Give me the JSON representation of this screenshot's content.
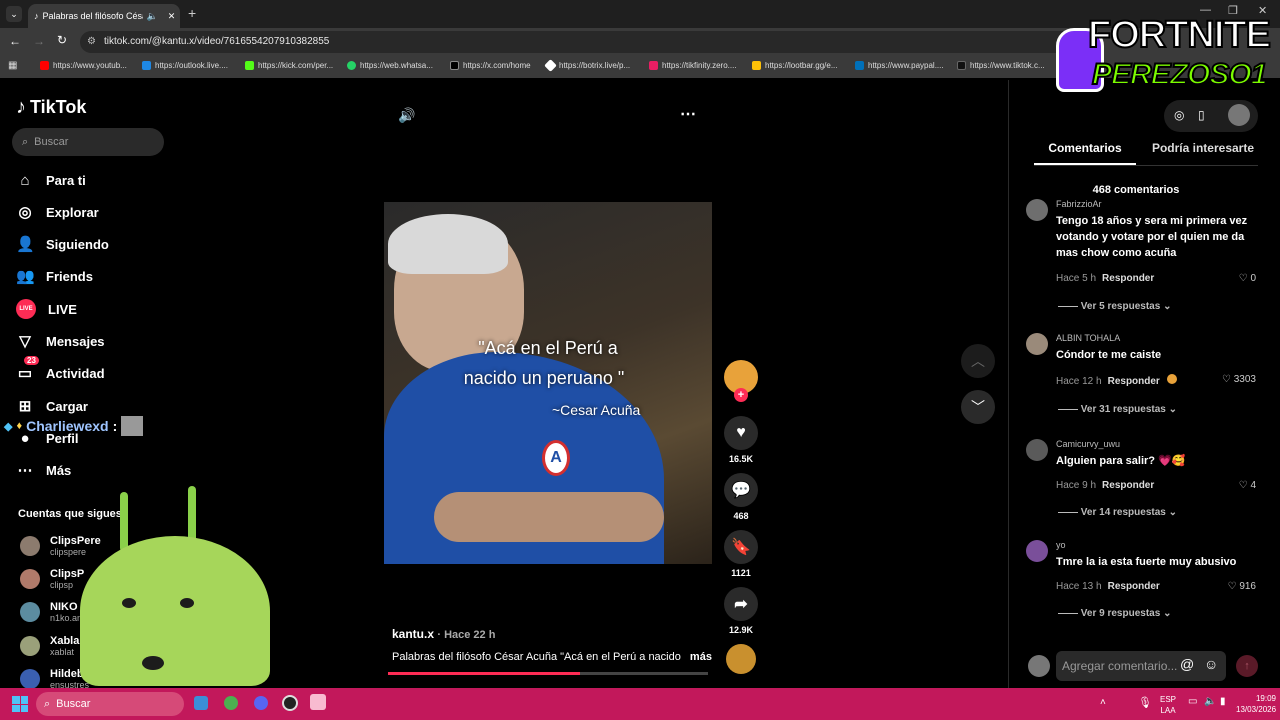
{
  "browser": {
    "tab_title": "Palabras del filósofo César A...",
    "url": "tiktok.com/@kantu.x/video/7616554207910382855",
    "bookmarks": [
      "https://www.youtub...",
      "https://outlook.live....",
      "https://kick.com/per...",
      "https://web.whatsa...",
      "https://x.com/home",
      "https://botrix.live/p...",
      "https://tikfinity.zero....",
      "https://lootbar.gg/e...",
      "https://www.paypal....",
      "https://www.tiktok.c..."
    ]
  },
  "overlay": {
    "logo_top": "FORTNITE",
    "logo_bottom": "PEREZOSO1",
    "chat_user": "Charliewexd",
    "chat_sep": ":"
  },
  "sidebar": {
    "brand": "TikTok",
    "search_placeholder": "Buscar",
    "items": [
      {
        "label": "Para ti",
        "icon": "home-icon"
      },
      {
        "label": "Explorar",
        "icon": "compass-icon"
      },
      {
        "label": "Siguiendo",
        "icon": "following-icon"
      },
      {
        "label": "Friends",
        "icon": "friends-icon"
      },
      {
        "label": "LIVE",
        "icon": "live-icon"
      },
      {
        "label": "Mensajes",
        "icon": "send-icon"
      },
      {
        "label": "Actividad",
        "icon": "activity-icon"
      },
      {
        "label": "Cargar",
        "icon": "upload-icon"
      },
      {
        "label": "Perfil",
        "icon": "profile-icon"
      },
      {
        "label": "Más",
        "icon": "more-icon"
      }
    ],
    "activity_badge": "23",
    "following_title": "Cuentas que sigues",
    "following": [
      {
        "name": "ClipsPere",
        "user": "clipspere"
      },
      {
        "name": "ClipsP",
        "user": "clipsp"
      },
      {
        "name": "NIKO",
        "user": "n1ko.an"
      },
      {
        "name": "Xabla",
        "user": "xablat"
      },
      {
        "name": "Hildebr",
        "user": "ensustres"
      }
    ]
  },
  "video": {
    "quote_line1": "\"Acá en el Perú a",
    "quote_line2": "nacido un peruano \"",
    "quote_author": "~Cesar Acuña",
    "author": "kantu.x",
    "time": "· Hace 22 h",
    "description": "Palabras del filósofo César Acuña \"Acá en el Perú a nacido",
    "more": "más",
    "progress": 0.6
  },
  "actions": {
    "likes": "16.5K",
    "comments": "468",
    "saves": "1121",
    "shares": "12.9K"
  },
  "comments_panel": {
    "tab_comments": "Comentarios",
    "tab_interest": "Podría interesarte",
    "count": "468 comentarios",
    "reply_label": "Responder",
    "input_placeholder": "Agregar comentario...",
    "items": [
      {
        "user": "FabrizzioAr",
        "text": "Tengo 18 años y sera mi primera vez votando y votare por el quien me da mas chow como acuña",
        "time": "Hace 5 h",
        "likes": "0",
        "replies": "Ver 5 respuestas"
      },
      {
        "user": "ALBIN TOHALA",
        "text": "Cóndor te me caiste",
        "time": "Hace 12 h",
        "likes": "3303",
        "replies": "Ver 31 respuestas"
      },
      {
        "user": "Camicurvy_uwu",
        "text": "Alguien para salir? 💗🥰",
        "time": "Hace 9 h",
        "likes": "4",
        "replies": "Ver 14 respuestas"
      },
      {
        "user": "yo",
        "text": "Tmre la ia esta fuerte muy abusivo",
        "time": "Hace 13 h",
        "likes": "916",
        "replies": "Ver 9 respuestas"
      }
    ]
  },
  "taskbar": {
    "search": "Buscar",
    "lang_top": "ESP",
    "lang_bottom": "LAA",
    "time": "19:09",
    "date": "13/03/2026"
  },
  "colors": {
    "accent": "#fe2c55",
    "taskbar": "#c2185b",
    "logo_green": "#7cfc00",
    "logo_purple": "#7b2ff7"
  }
}
